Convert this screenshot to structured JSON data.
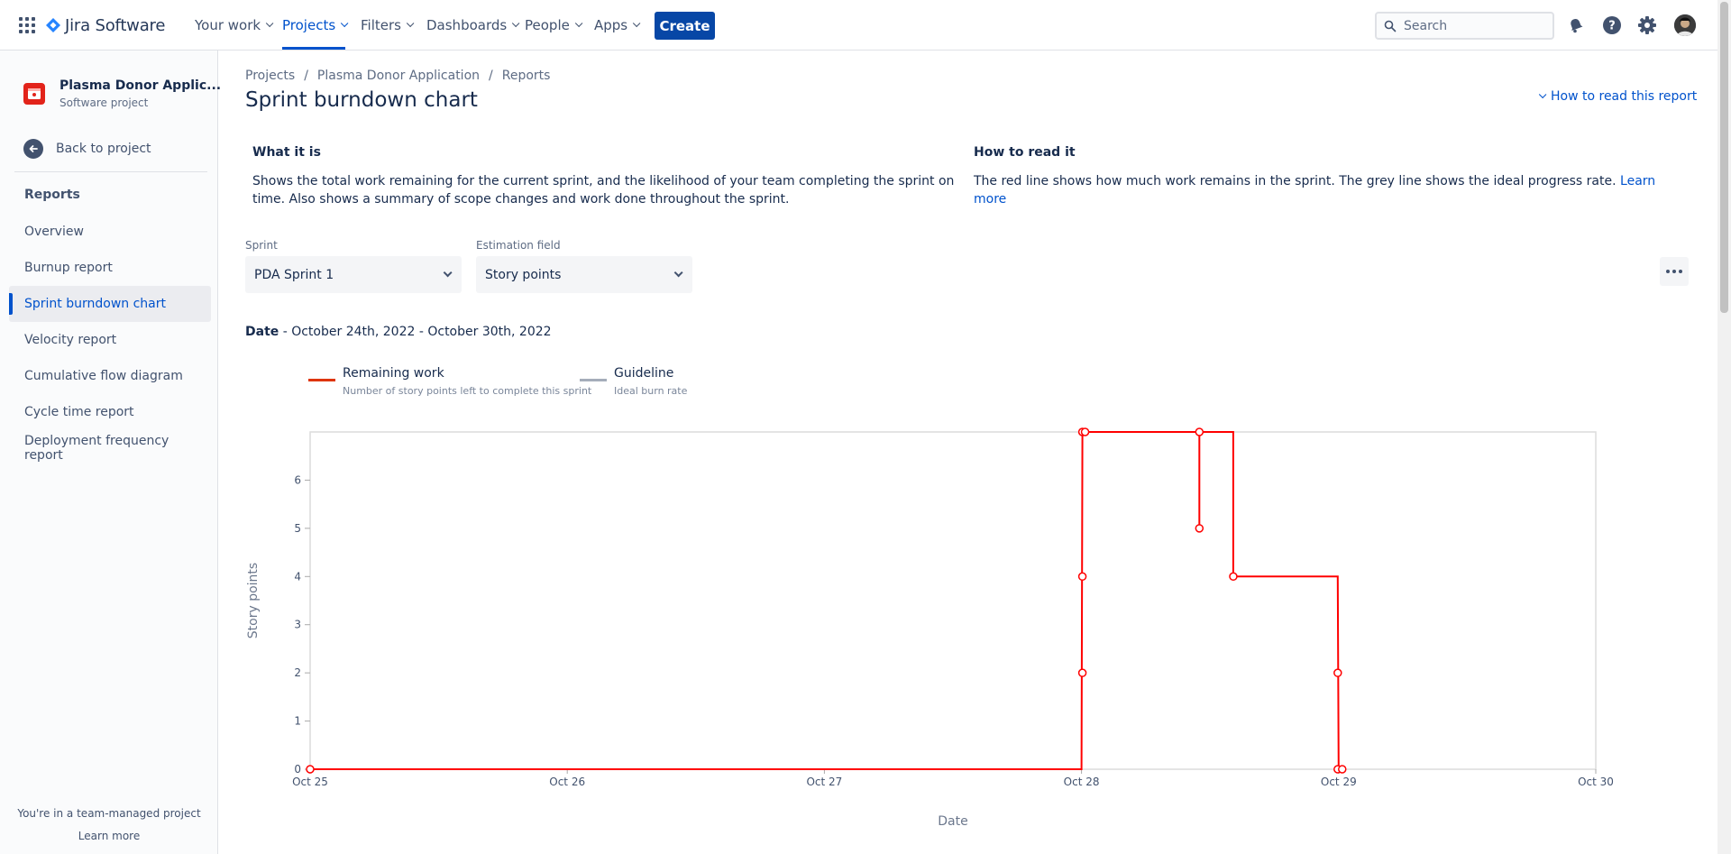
{
  "topnav": {
    "product": "Jira Software",
    "items": [
      {
        "label": "Your work"
      },
      {
        "label": "Projects"
      },
      {
        "label": "Filters"
      },
      {
        "label": "Dashboards"
      },
      {
        "label": "People"
      },
      {
        "label": "Apps"
      }
    ],
    "create_label": "Create",
    "search_placeholder": "Search"
  },
  "sidebar": {
    "project_name": "Plasma Donor Applic...",
    "project_type": "Software project",
    "back_label": "Back to project",
    "section_title": "Reports",
    "items": [
      {
        "label": "Overview"
      },
      {
        "label": "Burnup report"
      },
      {
        "label": "Sprint burndown chart"
      },
      {
        "label": "Velocity report"
      },
      {
        "label": "Cumulative flow diagram"
      },
      {
        "label": "Cycle time report"
      },
      {
        "label": "Deployment frequency report"
      }
    ],
    "footer_text": "You're in a team-managed project",
    "footer_link": "Learn more"
  },
  "breadcrumb": [
    "Projects",
    "Plasma Donor Application",
    "Reports"
  ],
  "page_title": "Sprint burndown chart",
  "howto_label": "How to read this report",
  "info": {
    "what_title": "What it is",
    "what_text": "Shows the total work remaining for the current sprint, and the likelihood of your team completing the sprint on time. Also shows a summary of scope changes and work done throughout the sprint.",
    "how_title": "How to read it",
    "how_text": "The red line shows how much work remains in the sprint. The grey line shows the ideal progress rate.",
    "how_link": "Learn more"
  },
  "filters": {
    "sprint_label": "Sprint",
    "sprint_value": "PDA Sprint 1",
    "estimation_label": "Estimation field",
    "estimation_value": "Story points"
  },
  "date_range": {
    "label": "Date",
    "value": "October 24th, 2022 - October 30th, 2022"
  },
  "legend": [
    {
      "title": "Remaining work",
      "subtitle": "Number of story points left to complete this sprint",
      "color": "#de350b"
    },
    {
      "title": "Guideline",
      "subtitle": "Ideal burn rate",
      "color": "#a5adba"
    }
  ],
  "colors": {
    "brand": "#0052cc",
    "create_button": "#0747a6",
    "remaining_line": "#ff0000",
    "guideline": "#a5adba",
    "project_icon": "#e2231a"
  },
  "chart_data": {
    "type": "line",
    "xlabel": "Date",
    "ylabel": "Story points",
    "x_ticks": [
      "Oct 25",
      "Oct 26",
      "Oct 27",
      "Oct 28",
      "Oct 29",
      "Oct 30"
    ],
    "y_ticks": [
      0,
      1,
      2,
      3,
      4,
      5,
      6
    ],
    "xlim": [
      "Oct 25",
      "Oct 30"
    ],
    "ylim": [
      0,
      7
    ],
    "grid": false,
    "series": [
      {
        "name": "Remaining work",
        "color": "#ff0000",
        "line": [
          {
            "x": "Oct 25 00:00",
            "y": 0
          },
          {
            "x": "Oct 28 00:00",
            "y": 0
          },
          {
            "x": "Oct 28 00:05",
            "y": 7
          },
          {
            "x": "Oct 28 11:00",
            "y": 7
          },
          {
            "x": "Oct 28 14:10",
            "y": 7
          },
          {
            "x": "Oct 28 14:10",
            "y": 4
          },
          {
            "x": "Oct 28 23:55",
            "y": 4
          },
          {
            "x": "Oct 29 00:00",
            "y": 0
          }
        ],
        "points": [
          {
            "x": "Oct 25 00:00",
            "y": 0
          },
          {
            "x": "Oct 28 00:05",
            "y": 2
          },
          {
            "x": "Oct 28 00:05",
            "y": 4
          },
          {
            "x": "Oct 28 00:05",
            "y": 7
          },
          {
            "x": "Oct 28 00:20",
            "y": 7
          },
          {
            "x": "Oct 28 11:00",
            "y": 7
          },
          {
            "x": "Oct 28 11:00",
            "y": 5
          },
          {
            "x": "Oct 28 14:10",
            "y": 4
          },
          {
            "x": "Oct 28 23:55",
            "y": 2
          },
          {
            "x": "Oct 28 23:55",
            "y": 0
          },
          {
            "x": "Oct 29 00:20",
            "y": 0
          }
        ],
        "spikes": [
          {
            "x": "Oct 28 11:00",
            "from": 7,
            "to": 5
          }
        ]
      }
    ]
  }
}
